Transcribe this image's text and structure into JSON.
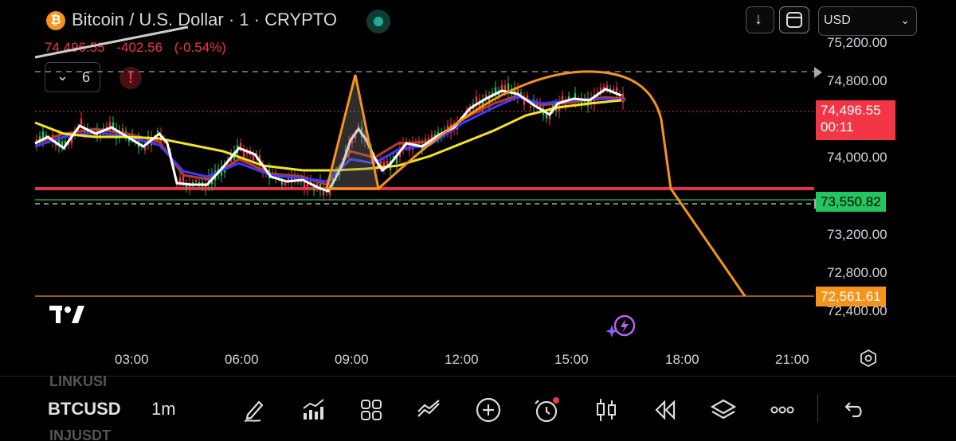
{
  "header": {
    "coin_glyph": "₿",
    "symbol_title": "Bitcoin / U.S. Dollar · 1 · CRYPTO",
    "last_price": "74,496.55",
    "change": "-402.56",
    "change_pct": "(-0.54%)",
    "currency": "USD",
    "currency_chevron": "⌄",
    "down_glyph": "↓"
  },
  "indicators": {
    "chevron": "⌄",
    "count": "6"
  },
  "alert_glyph": "!",
  "price_axis": {
    "ticks": [
      "75,200.00",
      "74,800.00",
      "74,000.00",
      "73,200.00",
      "72,800.00",
      "72,400.00"
    ],
    "current_price": "74,496.55",
    "countdown": "00:11",
    "green_level": "73,550.82",
    "orange_level": "72,561.61"
  },
  "time_axis": {
    "ticks": [
      "03:00",
      "06:00",
      "09:00",
      "12:00",
      "15:00",
      "18:00",
      "21:00"
    ]
  },
  "bottom_bar": {
    "ghost_top": "LINKUSI",
    "symbol": "BTCUSD",
    "ghost_bottom": "INJUSDT",
    "interval": "1m"
  },
  "colors": {
    "up": "#22c55e",
    "down": "#f23645",
    "drawing": "#f7931a",
    "ma_yellow": "#f5e51a",
    "ma_blue": "#3b3bff",
    "ma_red": "#c0392b"
  },
  "icons": {
    "toolbar": [
      "draw-icon",
      "indicators-chart-icon",
      "layout-grid-icon",
      "compare-icon",
      "add-circle-icon",
      "alert-clock-icon",
      "candles-icon",
      "replay-icon",
      "layers-icon",
      "more-icon",
      "undo-icon"
    ]
  }
}
